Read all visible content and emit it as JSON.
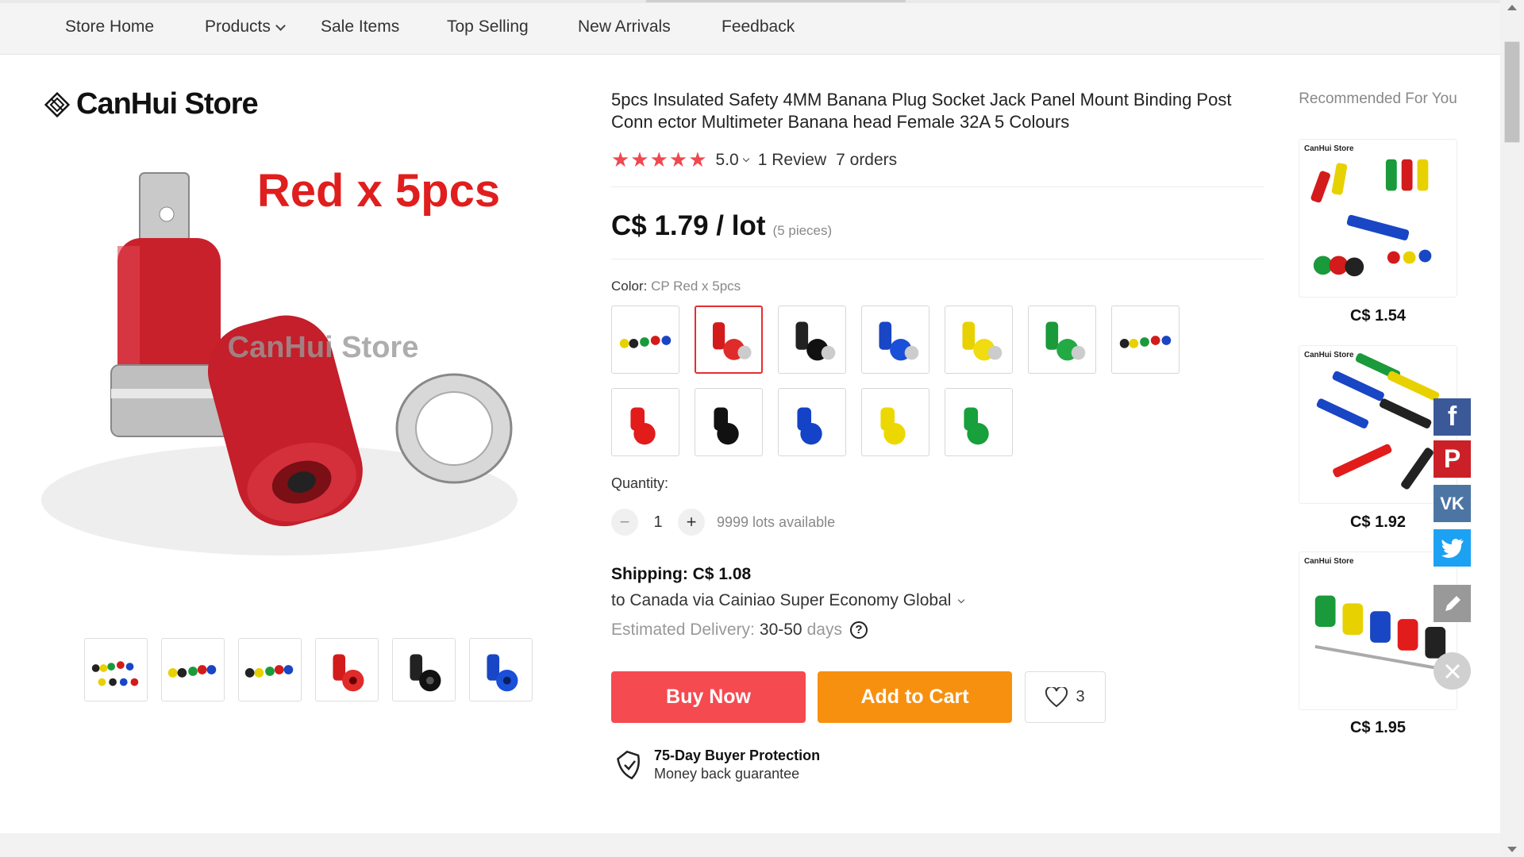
{
  "nav": {
    "items": [
      "Store Home",
      "Products",
      "Sale Items",
      "Top Selling",
      "New Arrivals",
      "Feedback"
    ]
  },
  "store": {
    "name": "CanHui Store"
  },
  "image": {
    "main_caption": "Red x 5pcs",
    "watermark": "CanHui Store"
  },
  "product": {
    "title": "5pcs Insulated Safety 4MM Banana Plug Socket Jack Panel Mount Binding Post Conn ector Multimeter Banana head Female 32A 5 Colours",
    "rating": "5.0",
    "stars": 5,
    "reviews": "1 Review",
    "orders": "7 orders",
    "price": "C$ 1.79 / lot",
    "pieces": "(5 pieces)",
    "color_label": "Color:",
    "color_value": "CP Red x 5pcs",
    "quantity_label": "Quantity:",
    "quantity": "1",
    "available": "9999 lots available",
    "shipping": "Shipping: C$ 1.08",
    "shipping_to": "to Canada via Cainiao Super Economy Global",
    "est_label": "Estimated Delivery:",
    "est_value": "30-50",
    "est_unit": "days",
    "buy_now": "Buy Now",
    "add_to_cart": "Add to Cart",
    "wishlist_count": "3",
    "protection_title": "75-Day Buyer Protection",
    "protection_sub": "Money back guarantee",
    "qty_minus": "−",
    "qty_plus": "+",
    "help": "?"
  },
  "recommended": {
    "heading": "Recommended For You",
    "prices": [
      "C$ 1.54",
      "C$ 1.92",
      "C$ 1.95"
    ]
  },
  "social": {
    "facebook": "f",
    "pinterest": "P",
    "vk": "VK"
  },
  "colors": {
    "accent_red": "#f54a4f",
    "accent_orange": "#f8900f",
    "star": "#f0484f"
  }
}
